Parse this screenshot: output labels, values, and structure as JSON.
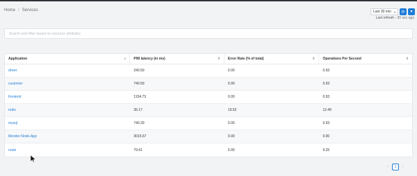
{
  "breadcrumb": [
    "Home",
    "Services"
  ],
  "time_range": {
    "selected": "Last 30 min"
  },
  "last_refresh": {
    "label": "Last refresh",
    "ago": "20 sec ago"
  },
  "search": {
    "placeholder": "Search and Filter based on resource attributes"
  },
  "table": {
    "columns": [
      "Application",
      "P99 latency (in ms)",
      "Error Rate (% of total)",
      "Operations Per Second"
    ],
    "rows": [
      [
        "driver",
        "240.59",
        "0.00",
        "0.93"
      ],
      [
        "customer",
        "740.59",
        "0.00",
        "0.93"
      ],
      [
        "frontend",
        "1154.73",
        "0.00",
        "0.93"
      ],
      [
        "redis",
        "35.17",
        "19.52",
        "12.49"
      ],
      [
        "mysql",
        "740.29",
        "0.00",
        "0.93"
      ],
      [
        "Monitor-Node-App",
        "3015.67",
        "0.00",
        "0.00"
      ],
      [
        "route",
        "79.61",
        "0.00",
        "9.25"
      ]
    ]
  },
  "pagination": {
    "current": "1",
    "prev": "‹",
    "next": "›"
  },
  "colors": {
    "accent": "#1f7cd6",
    "background": "#f2f3f5"
  }
}
